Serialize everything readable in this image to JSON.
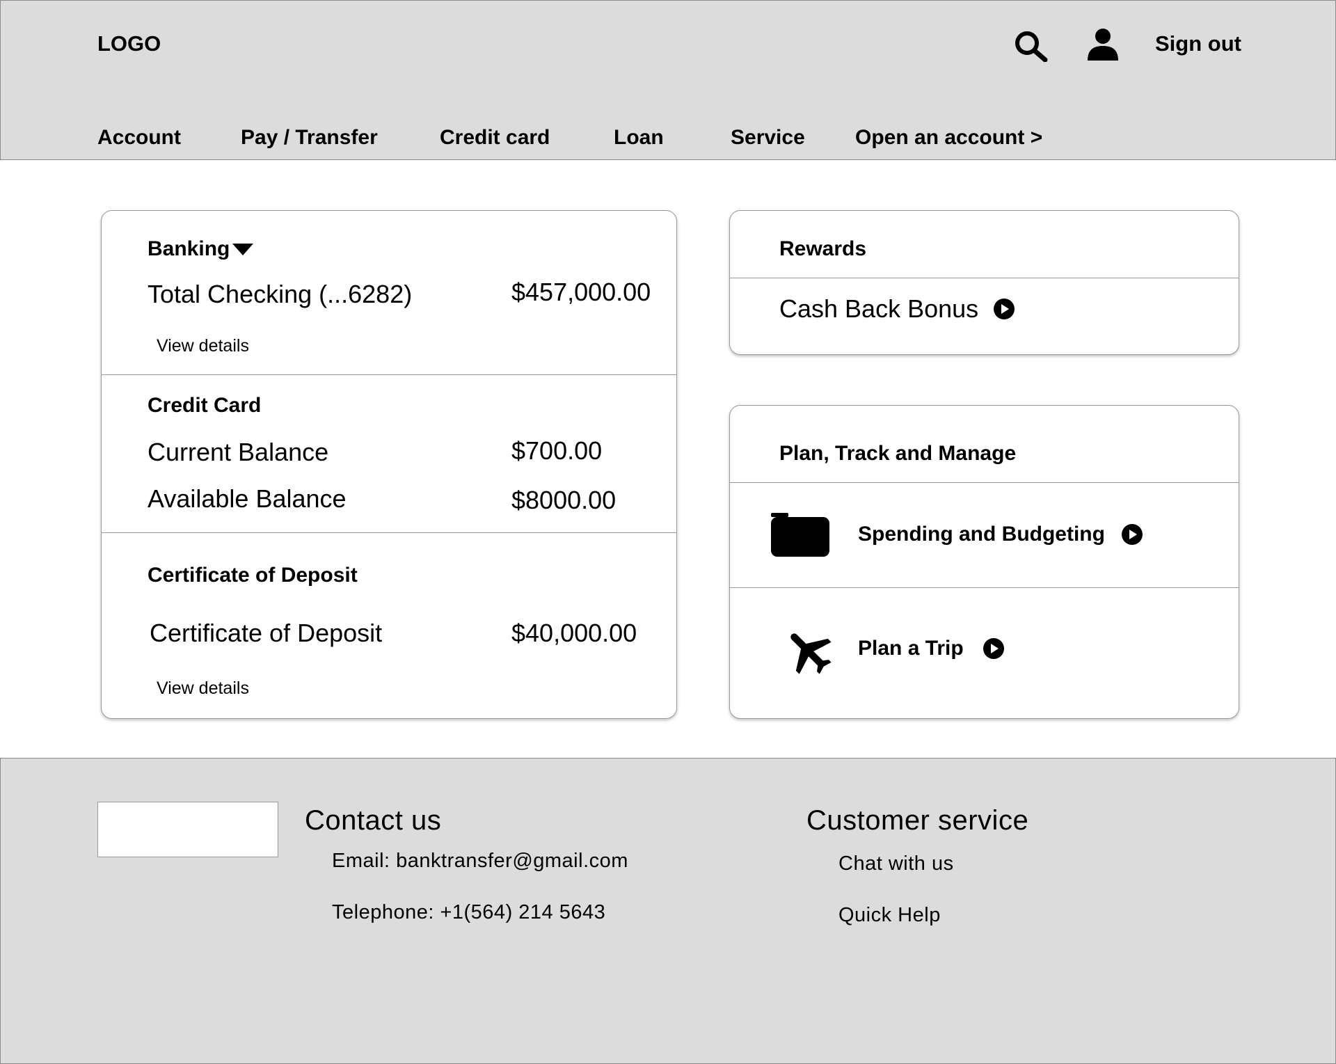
{
  "header": {
    "logo": "LOGO",
    "search_icon": "search-icon",
    "user_icon": "user-icon",
    "sign_out": "Sign out",
    "nav": [
      "Account",
      "Pay / Transfer",
      "Credit card",
      "Loan",
      "Service",
      "Open an account >"
    ]
  },
  "accounts": {
    "banking": {
      "title": "Banking",
      "account_name": "Total Checking (...6282)",
      "balance": "$457,000.00",
      "view_details": "View details"
    },
    "credit_card": {
      "title": "Credit Card",
      "current_label": "Current Balance",
      "current_value": "$700.00",
      "available_label": "Available Balance",
      "available_value": "$8000.00"
    },
    "cd": {
      "title": "Certificate of Deposit",
      "label": "Certificate of Deposit",
      "value": "$40,000.00",
      "view_details": "View details"
    }
  },
  "rewards": {
    "title": "Rewards",
    "item": "Cash Back Bonus"
  },
  "plan": {
    "title": "Plan, Track and Manage",
    "spending": "Spending and Budgeting",
    "trip": "Plan a Trip"
  },
  "footer": {
    "contact_title": "Contact us",
    "email": "Email: banktransfer@gmail.com",
    "telephone": "Telephone: +1(564) 214 5643",
    "service_title": "Customer service",
    "chat": "Chat with us",
    "help": "Quick Help"
  }
}
